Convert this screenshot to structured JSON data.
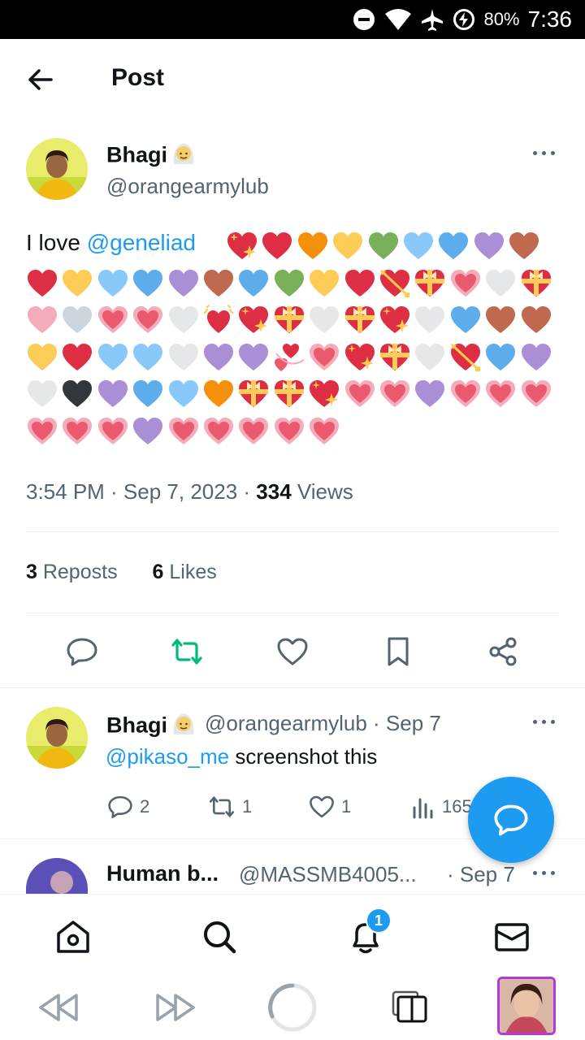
{
  "status_bar": {
    "battery": "80%",
    "time": "7:36"
  },
  "header": {
    "title": "Post"
  },
  "post": {
    "author_name": "Bhagi",
    "author_handle": "@orangearmylub",
    "text_prefix": "I love ",
    "mention": "@geneliad",
    "timestamp": "3:54 PM · Sep 7, 2023 · ",
    "views_count": "334",
    "views_label": " Views",
    "reposts_count": "3",
    "reposts_label": " Reposts",
    "likes_count": "6",
    "likes_label": " Likes",
    "heart_rows": [
      [
        "sparkling",
        "red",
        "orange",
        "yellow",
        "green",
        "lightblue",
        "blue",
        "purple",
        "brown"
      ],
      [
        "red",
        "yellow",
        "lightblue",
        "blue",
        "purple",
        "brown",
        "blue",
        "green",
        "yellow",
        "red",
        "arrow",
        "ribbon",
        "growing",
        "white",
        "ribbon"
      ],
      [
        "pink",
        "grey",
        "growing",
        "growing",
        "white",
        "beating",
        "sparkling",
        "ribbon",
        "white",
        "ribbon",
        "sparkling",
        "white",
        "blue",
        "brown",
        "brown"
      ],
      [
        "yellow",
        "red",
        "lightblue",
        "lightblue",
        "white",
        "purple",
        "purple",
        "revolving",
        "growing",
        "sparkling",
        "ribbon",
        "white",
        "arrow",
        "blue",
        "purple"
      ],
      [
        "white",
        "black",
        "purple",
        "blue",
        "lightblue",
        "orange",
        "ribbon",
        "ribbon",
        "sparkling",
        "growing",
        "growing",
        "purple",
        "growing",
        "growing",
        "growing"
      ],
      [
        "growing",
        "growing",
        "growing",
        "purple",
        "growing",
        "growing",
        "growing",
        "growing",
        "growing"
      ]
    ]
  },
  "reply": {
    "author_name": "Bhagi",
    "author_handle": "@orangearmylub",
    "date": " · Sep 7",
    "mention": "@pikaso_me",
    "text": " screenshot this",
    "replies": "2",
    "reposts": "1",
    "likes": "1",
    "views": "165"
  },
  "next_reply": {
    "author_name": "Human b...",
    "author_handle": "@MASSMB4005...",
    "date": "· Sep 7"
  },
  "bottom_nav": {
    "notification_badge": "1"
  },
  "colors": {
    "accent": "#1d9bf0",
    "repost_green": "#00ba7c",
    "text": "#0f1419",
    "muted": "#536471"
  }
}
